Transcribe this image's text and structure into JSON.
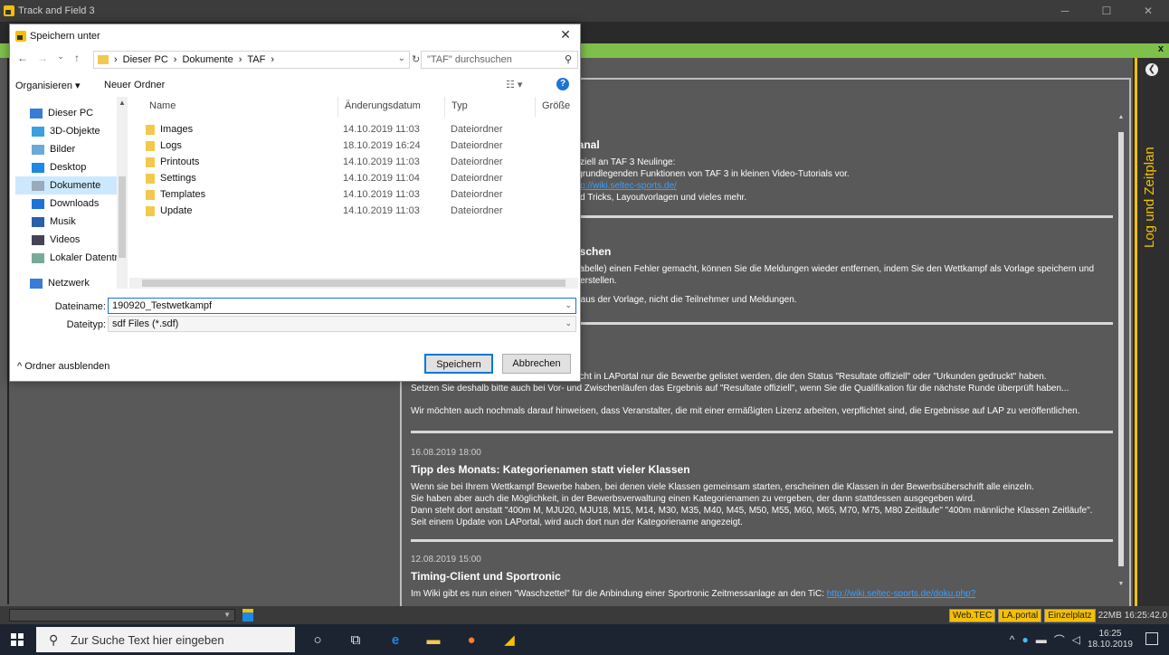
{
  "app": {
    "title": "Track and Field 3",
    "close_x": "x",
    "side_label": "Log und Zeitplan",
    "side_icon": "chevron-left"
  },
  "news": [
    {
      "date": "",
      "title": "Kanal",
      "lines": [
        "peziell an TAF 3 Neulinge:",
        "e grundlegenden Funktionen von TAF 3 in kleinen Video-Tutorials vor."
      ],
      "link": "http://wiki.seltec-sports.de/",
      "tail": "und Tricks, Layoutvorlagen und vieles mehr."
    },
    {
      "date": "",
      "title": "löschen",
      "lines": [
        "l-Tabelle) einen Fehler gemacht, können Sie die Meldungen wieder entfernen, indem Sie den Wettkampf als Vorlage speichern und",
        "pf erstellen.",
        "",
        "ur aus der Vorlage, nicht die Teilnehmer und Meldungen."
      ]
    },
    {
      "date": "",
      "title": "",
      "lines": [
        "rsicht in LAPortal nur die Bewerbe gelistet werden, die den Status \"Resultate offiziell\" oder \"Urkunden gedruckt\" haben.",
        "Setzen Sie deshalb bitte auch bei Vor- und Zwischenläufen das Ergebnis auf \"Resultate offiziell\", wenn Sie die Qualifikation für die nächste Runde überprüft haben...",
        "",
        "Wir möchten auch nochmals darauf hinweisen, dass Veranstalter, die mit einer ermäßigten Lizenz arbeiten, verpflichtet sind, die Ergebnisse auf LAP zu veröffentlichen."
      ]
    },
    {
      "date": "16.08.2019 18:00",
      "title": "Tipp des Monats: Kategorienamen statt vieler Klassen",
      "lines": [
        "Wenn sie bei Ihrem Wettkampf Bewerbe haben, bei denen viele Klassen gemeinsam starten, erscheinen die Klassen in der Bewerbsüberschrift alle einzeln.",
        "Sie haben aber auch die Möglichkeit, in der Bewerbsverwaltung einen Kategorienamen zu vergeben, der dann stattdessen ausgegeben wird.",
        "Dann steht dort anstatt \"400m M, MJU20, MJU18, M15, M14, M30, M35, M40, M45, M50, M55, M60, M65, M70, M75, M80 Zeitläufe\" \"400m männliche Klassen Zeitläufe\".",
        "Seit einem Update von LAPortal, wird auch dort nun der Kategoriename angezeigt."
      ]
    },
    {
      "date": "12.08.2019 15:00",
      "title": "Timing-Client und Sportronic",
      "lines": [
        "Im Wiki gibt es nun einen \"Waschzettel\" für die Anbindung einer Sportronic Zeitmessanlage an den TiC:"
      ],
      "link": "http://wiki.seltec-sports.de/doku.php?"
    }
  ],
  "status": {
    "badges": [
      "Web.TEC",
      "LA.portal",
      "Einzelplatz"
    ],
    "memory": "22MB",
    "time": "16:25:42.0"
  },
  "taskbar": {
    "search_placeholder": "Zur Suche Text hier eingeben",
    "time": "16:25",
    "date": "18.10.2019"
  },
  "dialog": {
    "title": "Speichern unter",
    "path": [
      "Dieser PC",
      "Dokumente",
      "TAF"
    ],
    "search_placeholder": "\"TAF\" durchsuchen",
    "organize": "Organisieren ▾",
    "new_folder": "Neuer Ordner",
    "nav_items": [
      {
        "label": "Dieser PC",
        "icon": "pc-icon",
        "color": "#3a7bd5"
      },
      {
        "label": "3D-Objekte",
        "icon": "cube-icon",
        "color": "#3aa0e0"
      },
      {
        "label": "Bilder",
        "icon": "pictures-icon",
        "color": "#6aa9d8"
      },
      {
        "label": "Desktop",
        "icon": "desktop-icon",
        "color": "#1e88e5"
      },
      {
        "label": "Dokumente",
        "icon": "documents-icon",
        "color": "#9ab"
      },
      {
        "label": "Downloads",
        "icon": "download-icon",
        "color": "#1e73d6"
      },
      {
        "label": "Musik",
        "icon": "music-icon",
        "color": "#2b5fa8"
      },
      {
        "label": "Videos",
        "icon": "video-icon",
        "color": "#445"
      },
      {
        "label": "Lokaler Datenträ",
        "icon": "drive-icon",
        "color": "#7a9"
      },
      {
        "label": "Netzwerk",
        "icon": "network-icon",
        "color": "#3a7bd5"
      }
    ],
    "columns": [
      "Name",
      "Änderungsdatum",
      "Typ",
      "Größe"
    ],
    "files": [
      {
        "name": "Images",
        "date": "14.10.2019 11:03",
        "type": "Dateiordner"
      },
      {
        "name": "Logs",
        "date": "18.10.2019 16:24",
        "type": "Dateiordner"
      },
      {
        "name": "Printouts",
        "date": "14.10.2019 11:03",
        "type": "Dateiordner"
      },
      {
        "name": "Settings",
        "date": "14.10.2019 11:04",
        "type": "Dateiordner"
      },
      {
        "name": "Templates",
        "date": "14.10.2019 11:03",
        "type": "Dateiordner"
      },
      {
        "name": "Update",
        "date": "14.10.2019 11:03",
        "type": "Dateiordner"
      }
    ],
    "filename_label": "Dateiname:",
    "filename_value": "190920_Testwetkampf",
    "filetype_label": "Dateityp:",
    "filetype_value": "sdf Files (*.sdf)",
    "hide_folders": "Ordner ausblenden",
    "save": "Speichern",
    "cancel": "Abbrechen"
  }
}
